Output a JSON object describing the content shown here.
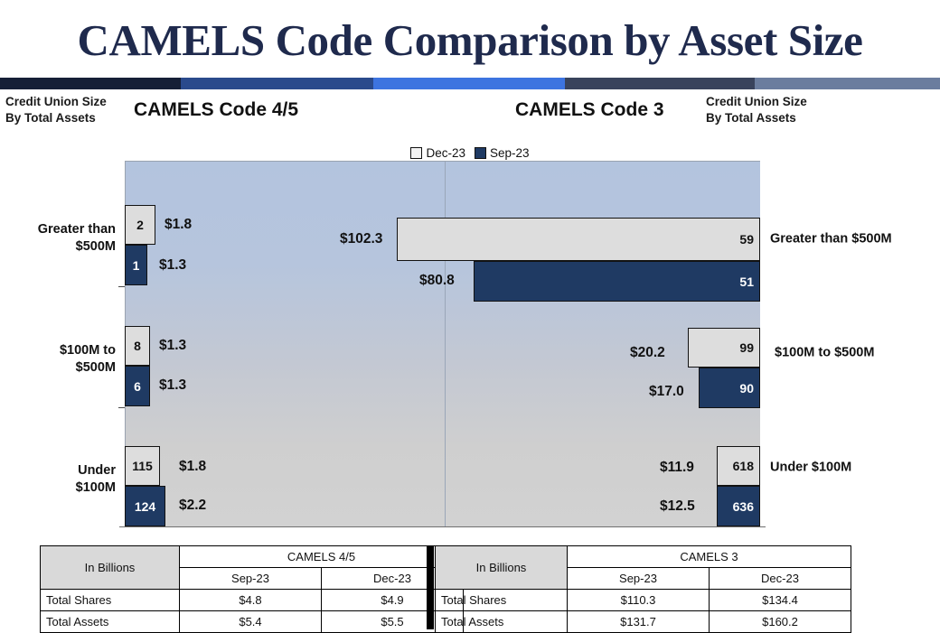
{
  "title": "CAMELS Code Comparison by Asset Size",
  "strip_segments": [
    {
      "name": "segment-1",
      "color": "#151f36",
      "width_pct": 19.2
    },
    {
      "name": "segment-2",
      "color": "#2a4a8c",
      "width_pct": 20.5
    },
    {
      "name": "segment-3",
      "color": "#3d74e0",
      "width_pct": 20.4
    },
    {
      "name": "segment-4",
      "color": "#39435c",
      "width_pct": 20.2
    },
    {
      "name": "segment-5",
      "color": "#6b7d9e",
      "width_pct": 19.7
    }
  ],
  "header": {
    "left_caption_line1": "Credit Union Size",
    "left_caption_line2": "By Total Assets",
    "right_caption_line1": "Credit Union Size",
    "right_caption_line2": "By Total Assets",
    "left_code": "CAMELS Code 4/5",
    "right_code": "CAMELS Code 3"
  },
  "legend": {
    "dec_label": "Dec-23",
    "sep_label": "Sep-23",
    "dec_color": "#f2f2f2",
    "sep_color": "#1f3a63"
  },
  "chart_data": {
    "type": "bar",
    "title": "CAMELS Code Comparison by Asset Size",
    "orientation": "horizontal",
    "panels": [
      {
        "name": "CAMELS Code 4/5",
        "side": "left",
        "categories": [
          "Greater than $500M",
          "$100M to $500M",
          "Under $100M"
        ],
        "series": [
          {
            "name": "Dec-23",
            "counts": [
              2,
              8,
              115
            ],
            "assets_billions": [
              1.8,
              1.3,
              1.8
            ],
            "value_labels": [
              "$1.8",
              "$1.3",
              "$1.8"
            ],
            "count_labels": [
              "2",
              "8",
              "115"
            ]
          },
          {
            "name": "Sep-23",
            "counts": [
              1,
              6,
              124
            ],
            "assets_billions": [
              1.3,
              1.3,
              2.2
            ],
            "value_labels": [
              "$1.3",
              "$1.3",
              "$2.2"
            ],
            "count_labels": [
              "1",
              "6",
              "124"
            ]
          }
        ]
      },
      {
        "name": "CAMELS Code 3",
        "side": "right",
        "categories": [
          "Greater than $500M",
          "$100M to $500M",
          "Under $100M"
        ],
        "series": [
          {
            "name": "Dec-23",
            "counts": [
              59,
              99,
              618
            ],
            "assets_billions": [
              102.3,
              20.2,
              11.9
            ],
            "value_labels": [
              "$102.3",
              "$20.2",
              "$11.9"
            ],
            "count_labels": [
              "59",
              "99",
              "618"
            ]
          },
          {
            "name": "Sep-23",
            "counts": [
              51,
              90,
              636
            ],
            "assets_billions": [
              80.8,
              17.0,
              12.5
            ],
            "value_labels": [
              "$80.8",
              "$17.0",
              "$12.5"
            ],
            "count_labels": [
              "51",
              "90",
              "636"
            ]
          }
        ]
      }
    ],
    "legend": [
      "Dec-23",
      "Sep-23"
    ],
    "grid": false,
    "legend_position": "top-center"
  },
  "cat_left": {
    "r0_l1": "Greater than",
    "r0_l2": "$500M",
    "r1_l1": "$100M to",
    "r1_l2": "$500M",
    "r2_l1": "Under",
    "r2_l2": "$100M"
  },
  "cat_right": {
    "r0": "Greater than $500M",
    "r1": "$100M to $500M",
    "r2": "Under $100M"
  },
  "bars_left": {
    "r0_dec_cnt": "2",
    "r0_dec_val": "$1.8",
    "r0_sep_cnt": "1",
    "r0_sep_val": "$1.3",
    "r1_dec_cnt": "8",
    "r1_dec_val": "$1.3",
    "r1_sep_cnt": "6",
    "r1_sep_val": "$1.3",
    "r2_dec_cnt": "115",
    "r2_dec_val": "$1.8",
    "r2_sep_cnt": "124",
    "r2_sep_val": "$2.2"
  },
  "bars_right": {
    "r0_dec_cnt": "59",
    "r0_dec_val": "$102.3",
    "r0_sep_cnt": "51",
    "r0_sep_val": "$80.8",
    "r1_dec_cnt": "99",
    "r1_dec_val": "$20.2",
    "r1_sep_cnt": "90",
    "r1_sep_val": "$17.0",
    "r2_dec_cnt": "618",
    "r2_dec_val": "$11.9",
    "r2_sep_cnt": "636",
    "r2_sep_val": "$12.5"
  },
  "table_left": {
    "corner": "In Billions",
    "group": "CAMELS 4/5",
    "col1": "Sep-23",
    "col2": "Dec-23",
    "rows": [
      {
        "label": "Total Shares",
        "sep": "$4.8",
        "dec": "$4.9"
      },
      {
        "label": "Total Assets",
        "sep": "$5.4",
        "dec": "$5.5"
      }
    ]
  },
  "table_right": {
    "corner": "In Billions",
    "group": "CAMELS 3",
    "col1": "Sep-23",
    "col2": "Dec-23",
    "rows": [
      {
        "label": "Total Shares",
        "sep": "$110.3",
        "dec": "$134.4"
      },
      {
        "label": "Total Assets",
        "sep": "$131.7",
        "dec": "$160.2"
      }
    ]
  }
}
